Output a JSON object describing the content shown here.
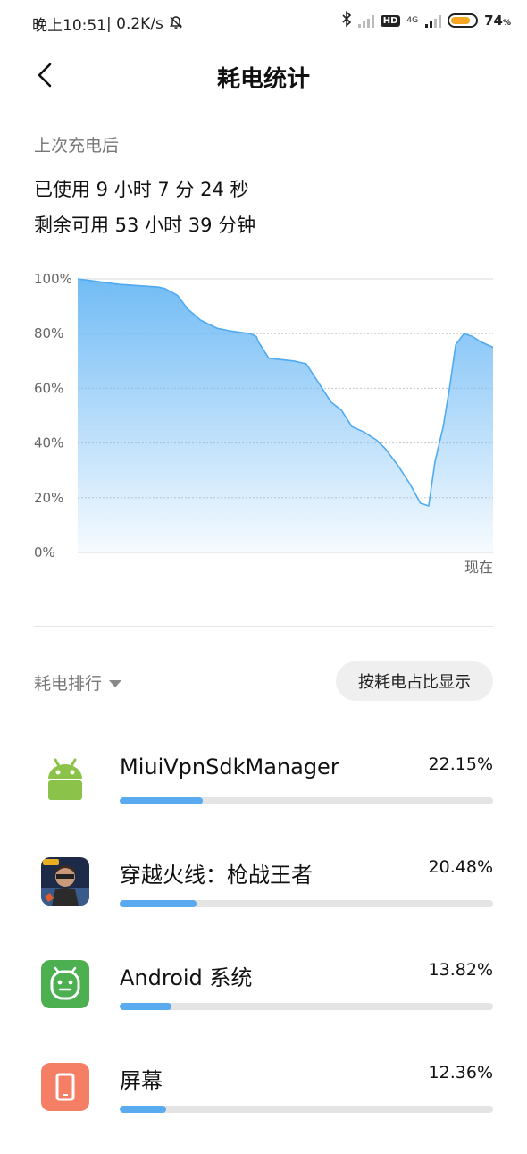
{
  "status_bar": {
    "time": "晚上10:51",
    "speed": "0.2K/s",
    "net_type": "4G",
    "hd_label": "HD",
    "battery_percent": "74",
    "battery_unit": "%"
  },
  "header": {
    "title": "耗电统计"
  },
  "summary": {
    "since_label": "上次充电后",
    "used": "已使用 9 小时 7 分 24 秒",
    "remaining": "剩余可用 53 小时 39 分钟"
  },
  "chart_data": {
    "type": "area",
    "y_ticks": [
      "100%",
      "80%",
      "60%",
      "40%",
      "20%",
      "0%"
    ],
    "ylim": [
      0,
      100
    ],
    "x_end_label": "现在",
    "grid": true,
    "color": "#4eaaf2",
    "series": [
      {
        "x": [
          0,
          5,
          10,
          15,
          19.5,
          21,
          24,
          26.5,
          29.5,
          33.5,
          36.5,
          39,
          41.5,
          43,
          43.5,
          46,
          49,
          52,
          55,
          58,
          61,
          63.5,
          66,
          69,
          72,
          74,
          77,
          80,
          82.5,
          84.5,
          86,
          88,
          89.5,
          91,
          93,
          95,
          97,
          100
        ],
        "y": [
          100,
          99,
          98,
          97.5,
          97,
          96.5,
          94,
          89,
          85,
          82,
          81,
          80.5,
          80,
          79,
          77,
          71,
          70.5,
          70,
          69,
          62,
          55,
          52,
          46,
          44,
          41,
          38,
          32,
          25,
          18,
          17,
          33,
          46,
          60,
          76,
          80,
          79,
          77,
          75
        ]
      }
    ]
  },
  "ranking": {
    "label": "耗电排行",
    "toggle_label": "按耗电占比显示"
  },
  "apps": [
    {
      "name": "MiuiVpnSdkManager",
      "percent": "22.15%",
      "fraction": 0.2215,
      "icon": "android-robot-icon"
    },
    {
      "name": "穿越火线：枪战王者",
      "percent": "20.48%",
      "fraction": 0.2048,
      "icon": "crossfire-game-icon"
    },
    {
      "name": "Android 系统",
      "percent": "13.82%",
      "fraction": 0.1382,
      "icon": "android-system-icon"
    },
    {
      "name": "屏幕",
      "percent": "12.36%",
      "fraction": 0.1236,
      "icon": "screen-icon"
    }
  ],
  "colors": {
    "accent": "#5aaaf0",
    "android_green": "#8bc34a",
    "system_green": "#4caf50",
    "screen_orange": "#f47f64"
  }
}
